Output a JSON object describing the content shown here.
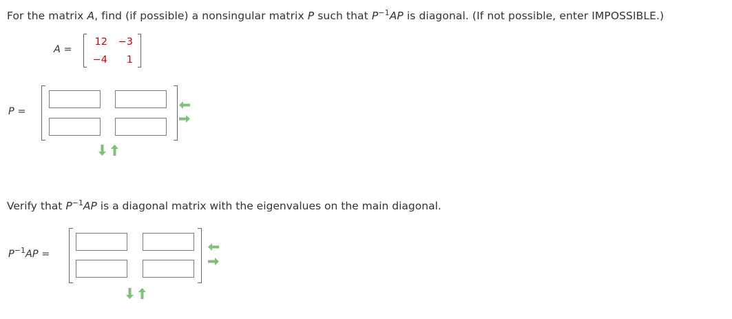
{
  "question": {
    "text_before_A": "For the matrix ",
    "var_A": "A",
    "text_find": ", find (if possible) a nonsingular matrix ",
    "var_P": "P",
    "text_such_that": " such that ",
    "expr_P": "P",
    "expr_exp": "−1",
    "expr_AP": "AP",
    "text_after": " is diagonal. (If not possible, enter IMPOSSIBLE.)"
  },
  "matrix_A": {
    "label": "A =",
    "rows": [
      [
        "12",
        "−3"
      ],
      [
        "−4",
        "1"
      ]
    ]
  },
  "matrix_P": {
    "label": "P ="
  },
  "verify": {
    "text_before": "Verify that ",
    "expr_P": "P",
    "expr_exp": "−1",
    "expr_AP": "AP",
    "text_after": " is a diagonal matrix with the eigenvalues on the main diagonal."
  },
  "matrix_D": {
    "label_P": "P",
    "label_exp": "−1",
    "label_AP": "AP",
    "label_eq": " ="
  },
  "colors": {
    "arrow_green": "#7cc176",
    "entry_red": "#cc0000"
  }
}
